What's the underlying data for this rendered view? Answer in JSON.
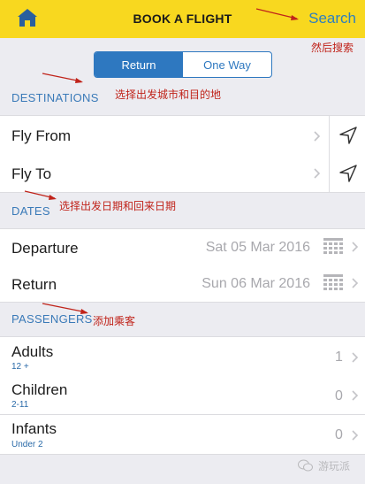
{
  "header": {
    "title": "BOOK A FLIGHT",
    "search_label": "Search"
  },
  "trip_type": {
    "options": [
      "Return",
      "One Way"
    ],
    "selected": "Return"
  },
  "destinations": {
    "section_label": "DESTINATIONS",
    "from_label": "Fly From",
    "to_label": "Fly To"
  },
  "dates": {
    "section_label": "DATES",
    "departure_label": "Departure",
    "departure_value": "Sat 05 Mar 2016",
    "return_label": "Return",
    "return_value": "Sun 06 Mar 2016"
  },
  "passengers": {
    "section_label": "PASSENGERS",
    "rows": [
      {
        "label": "Adults",
        "sub": "12 +",
        "count": "1"
      },
      {
        "label": "Children",
        "sub": "2-11",
        "count": "0"
      },
      {
        "label": "Infants",
        "sub": "Under 2",
        "count": "0"
      }
    ]
  },
  "annotations": {
    "search": "然后搜索",
    "destinations": "选择出发城市和目的地",
    "dates": "选择出发日期和回来日期",
    "passengers": "添加乘客"
  },
  "watermark": "游玩派",
  "colors": {
    "header_bg": "#f8d81f",
    "accent": "#2e78c0",
    "annotation": "#c0231a"
  },
  "icons": [
    "home-icon",
    "chevron-right-icon",
    "location-arrow-icon",
    "calendar-grid-icon",
    "wechat-icon"
  ]
}
